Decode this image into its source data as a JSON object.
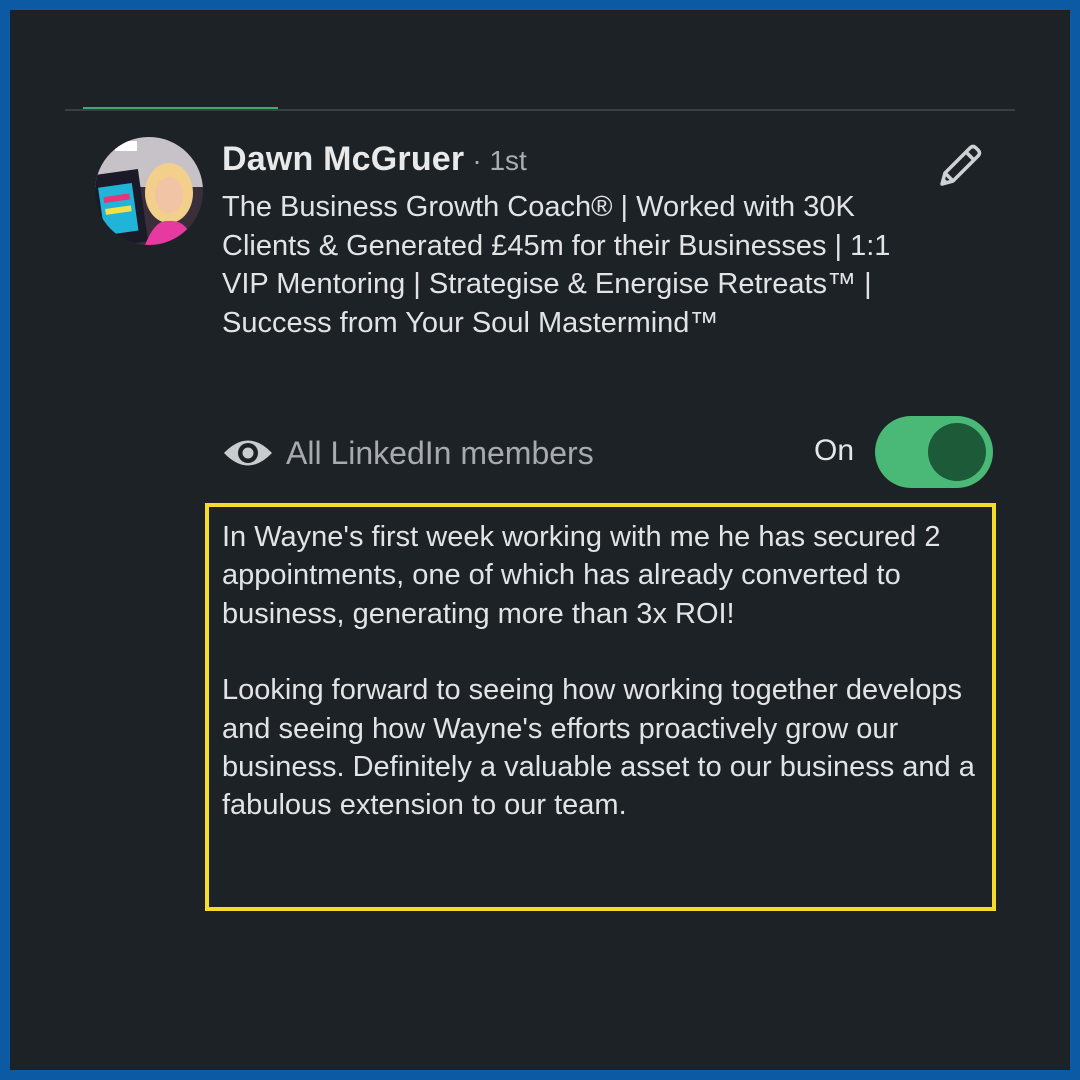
{
  "profile": {
    "name": "Dawn McGruer",
    "degree": "· 1st",
    "headline": "The Business Growth Coach® | Worked with 30K Clients & Generated £45m for their Businesses | 1:1 VIP Mentoring | Strategise & Energise Retreats™ | Success from Your Soul Mastermind™",
    "avatar_icon": "profile-photo"
  },
  "actions": {
    "edit_icon": "pencil-icon"
  },
  "visibility": {
    "icon": "eye-icon",
    "label": "All LinkedIn members",
    "toggle_state_label": "On",
    "toggle_on": true
  },
  "recommendation": {
    "paragraphs": [
      "In Wayne's first week working with me he has secured 2 appointments, one of which has already converted to business, generating more than 3x ROI!",
      "Looking forward to seeing how working together develops and seeing how Wayne's efforts proactively grow our business. Definitely a valuable asset to our business and a fabulous extension to our team."
    ]
  },
  "colors": {
    "frame_border": "#0b5aa3",
    "background": "#1d2226",
    "toggle_on": "#4ab877",
    "toggle_knob": "#1d5a37",
    "highlight": "#f5dc2a",
    "tab_indicator": "#3fa86b"
  }
}
